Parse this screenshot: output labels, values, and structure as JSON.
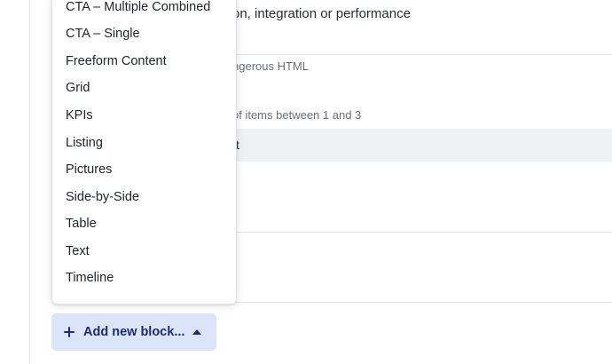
{
  "background": {
    "heading_fragment": "on, integration or performance",
    "subtext_fragment_1": "ngerous HTML",
    "subtext_fragment_2": "of items between 1 and 3",
    "highlight_fragment": "t"
  },
  "dropdown": {
    "items": [
      "CTA – Multiple Combined",
      "CTA – Single",
      "Freeform Content",
      "Grid",
      "KPIs",
      "Listing",
      "Pictures",
      "Side-by-Side",
      "Table",
      "Text",
      "Timeline"
    ]
  },
  "add_button": {
    "label": "Add new block...",
    "icon": "plus-icon",
    "state_icon": "caret-up-icon"
  },
  "colors": {
    "button_bg": "#dbe5fa",
    "button_text": "#1f2b6e",
    "highlight_row": "#f0f1f4"
  }
}
